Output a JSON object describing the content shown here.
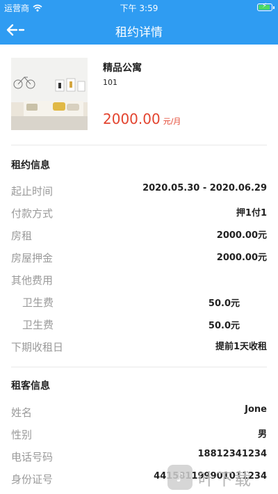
{
  "status_bar": {
    "carrier": "运营商",
    "time": "下午 3:59",
    "battery_level": 0.9
  },
  "nav": {
    "title": "租约详情",
    "back_icon": "arrow-left-icon"
  },
  "listing": {
    "name": "精品公寓",
    "room": "101",
    "price": "2000.00",
    "price_unit": "元/月"
  },
  "lease": {
    "title": "租约信息",
    "rows": [
      {
        "label": "起止时间",
        "value": "2020.05.30 - 2020.06.29"
      },
      {
        "label": "付款方式",
        "value": "押1付1"
      },
      {
        "label": "房租",
        "value": "2000.00元"
      },
      {
        "label": "房屋押金",
        "value": "2000.00元"
      },
      {
        "label": "其他费用",
        "value": ""
      },
      {
        "label": "卫生费",
        "value": "50.0元"
      },
      {
        "label": "卫生费",
        "value": "50.0元"
      },
      {
        "label": "下期收租日",
        "value": "提前1天收租"
      }
    ]
  },
  "tenant": {
    "title": "租客信息",
    "rows": [
      {
        "label": "姓名",
        "value": "Jone"
      },
      {
        "label": "性别",
        "value": "男"
      },
      {
        "label": "电话号码",
        "value": "18812341234"
      },
      {
        "label": "身份证号",
        "value": "441581199901011234"
      }
    ]
  },
  "watermark": {
    "text": "叶下载"
  },
  "colors": {
    "primary": "#2f9cf2",
    "price": "#e3442f",
    "label": "#9a9a9a"
  }
}
